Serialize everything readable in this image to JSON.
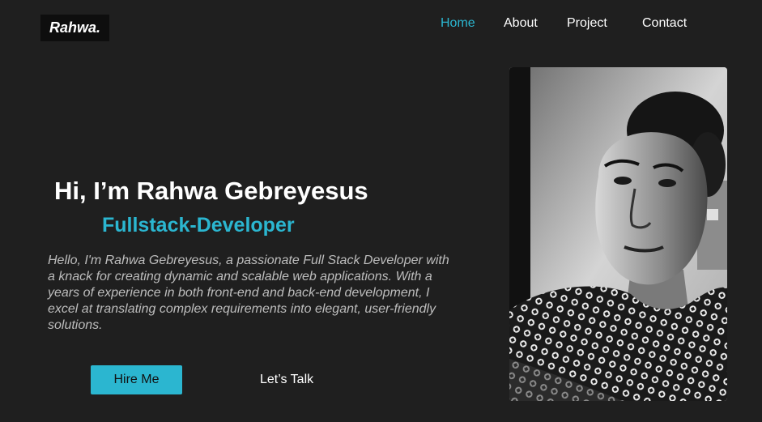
{
  "header": {
    "logo": "Rahwa.",
    "nav": [
      {
        "label": "Home",
        "active": true
      },
      {
        "label": "About",
        "active": false
      },
      {
        "label": "Project",
        "active": false
      },
      {
        "label": "Contact",
        "active": false
      }
    ]
  },
  "hero": {
    "headline": "Hi, I’m Rahwa Gebreyesus",
    "role": "Fullstack-Developer",
    "bio": "Hello, I'm Rahwa Gebreyesus, a passionate Full Stack Developer with a knack for creating dynamic and scalable web applications. With a years of experience in both front-end and back-end development, I excel at translating complex requirements into elegant, user-friendly solutions.",
    "hire_label": "Hire Me",
    "talk_label": "Let’s Talk"
  },
  "colors": {
    "accent": "#2bb6d0",
    "background": "#1f1f1f",
    "logo_bg": "#0e0e0e"
  }
}
